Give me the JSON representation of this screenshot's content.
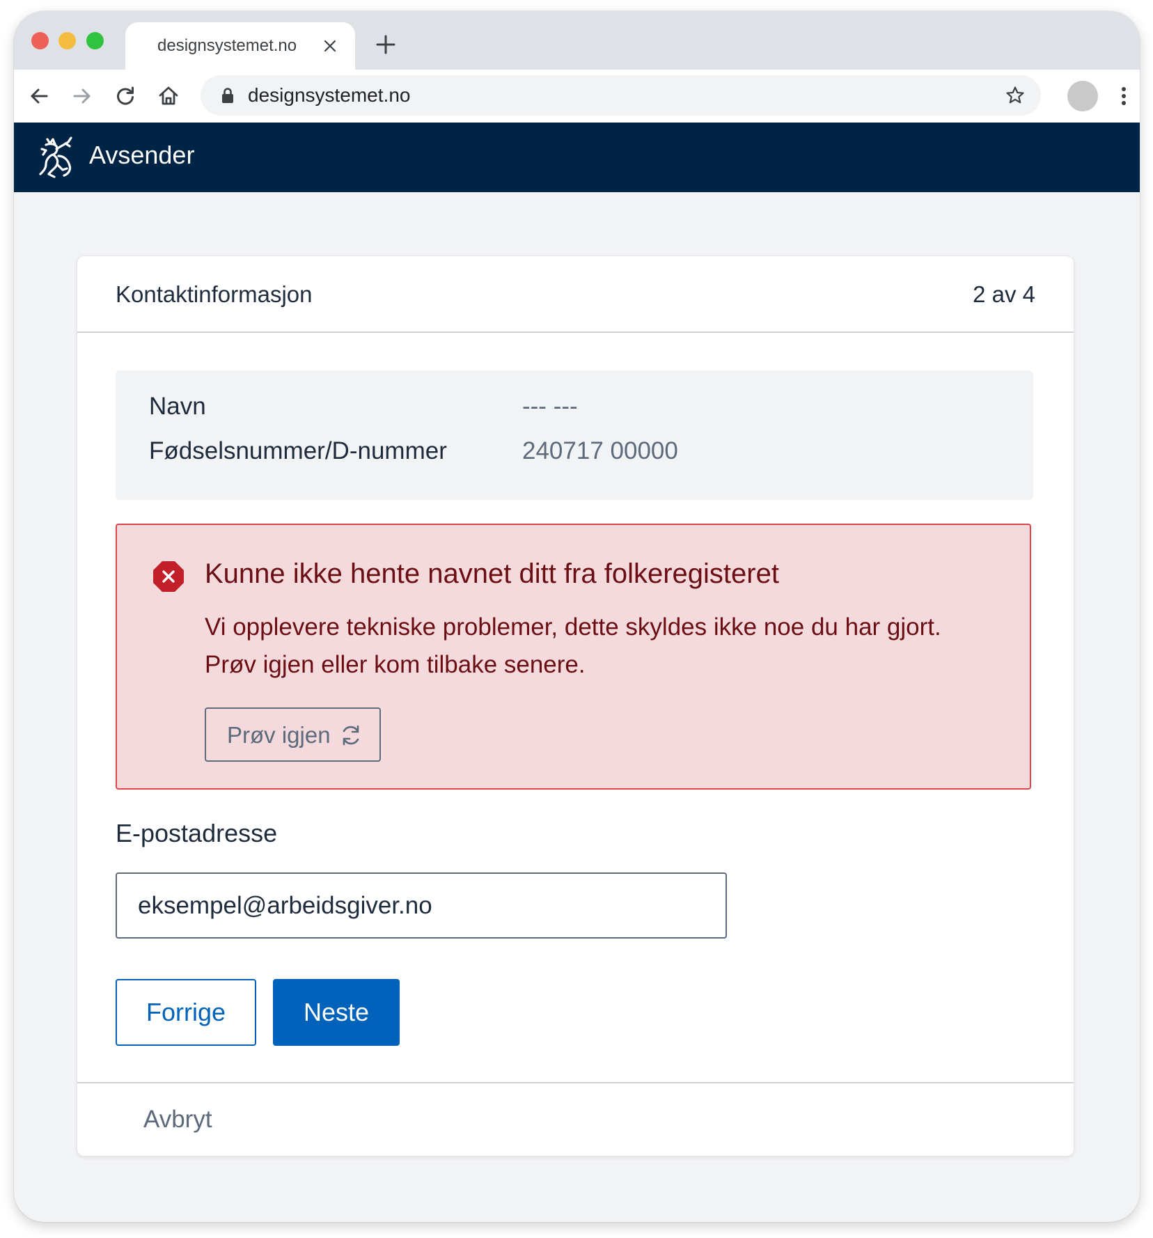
{
  "browser": {
    "tab_title": "designsystemet.no",
    "url": "designsystemet.no",
    "colors": {
      "traffic_red": "#ee5f57",
      "traffic_yellow": "#f5bd3f",
      "traffic_green": "#30c33f"
    },
    "icons": {
      "back": "arrow-left-icon",
      "forward": "arrow-right-icon",
      "reload": "reload-icon",
      "home": "home-icon",
      "lock": "lock-icon",
      "bookmark": "star-icon",
      "menu": "kebab-menu-icon"
    }
  },
  "site": {
    "title": "Avsender",
    "header_color": "#002445",
    "logo": "norwegian-coat-of-arms-lion"
  },
  "card": {
    "title": "Kontaktinformasjon",
    "step": "2 av 4",
    "info": [
      {
        "label": "Navn",
        "value": "--- ---"
      },
      {
        "label": "Fødselsnummer/D-nummer",
        "value": "240717 00000"
      }
    ],
    "alert": {
      "type": "error",
      "icon": "error-octagon-icon",
      "title": "Kunne ikke hente navnet ditt fra folkeregisteret",
      "body": "Vi opplevere tekniske problemer, dette skyldes ikke noe du har gjort. Prøv igjen eller kom tilbake senere.",
      "retry_label": "Prøv igjen",
      "colors": {
        "background": "#f4dadc",
        "border": "#e0444d",
        "text": "#6b0e14"
      }
    },
    "email": {
      "label": "E-postadresse",
      "value": "eksempel@arbeidsgiver.no"
    },
    "buttons": {
      "previous": "Forrige",
      "next": "Neste",
      "accent_color": "#0062ba"
    },
    "cancel": "Avbryt"
  }
}
